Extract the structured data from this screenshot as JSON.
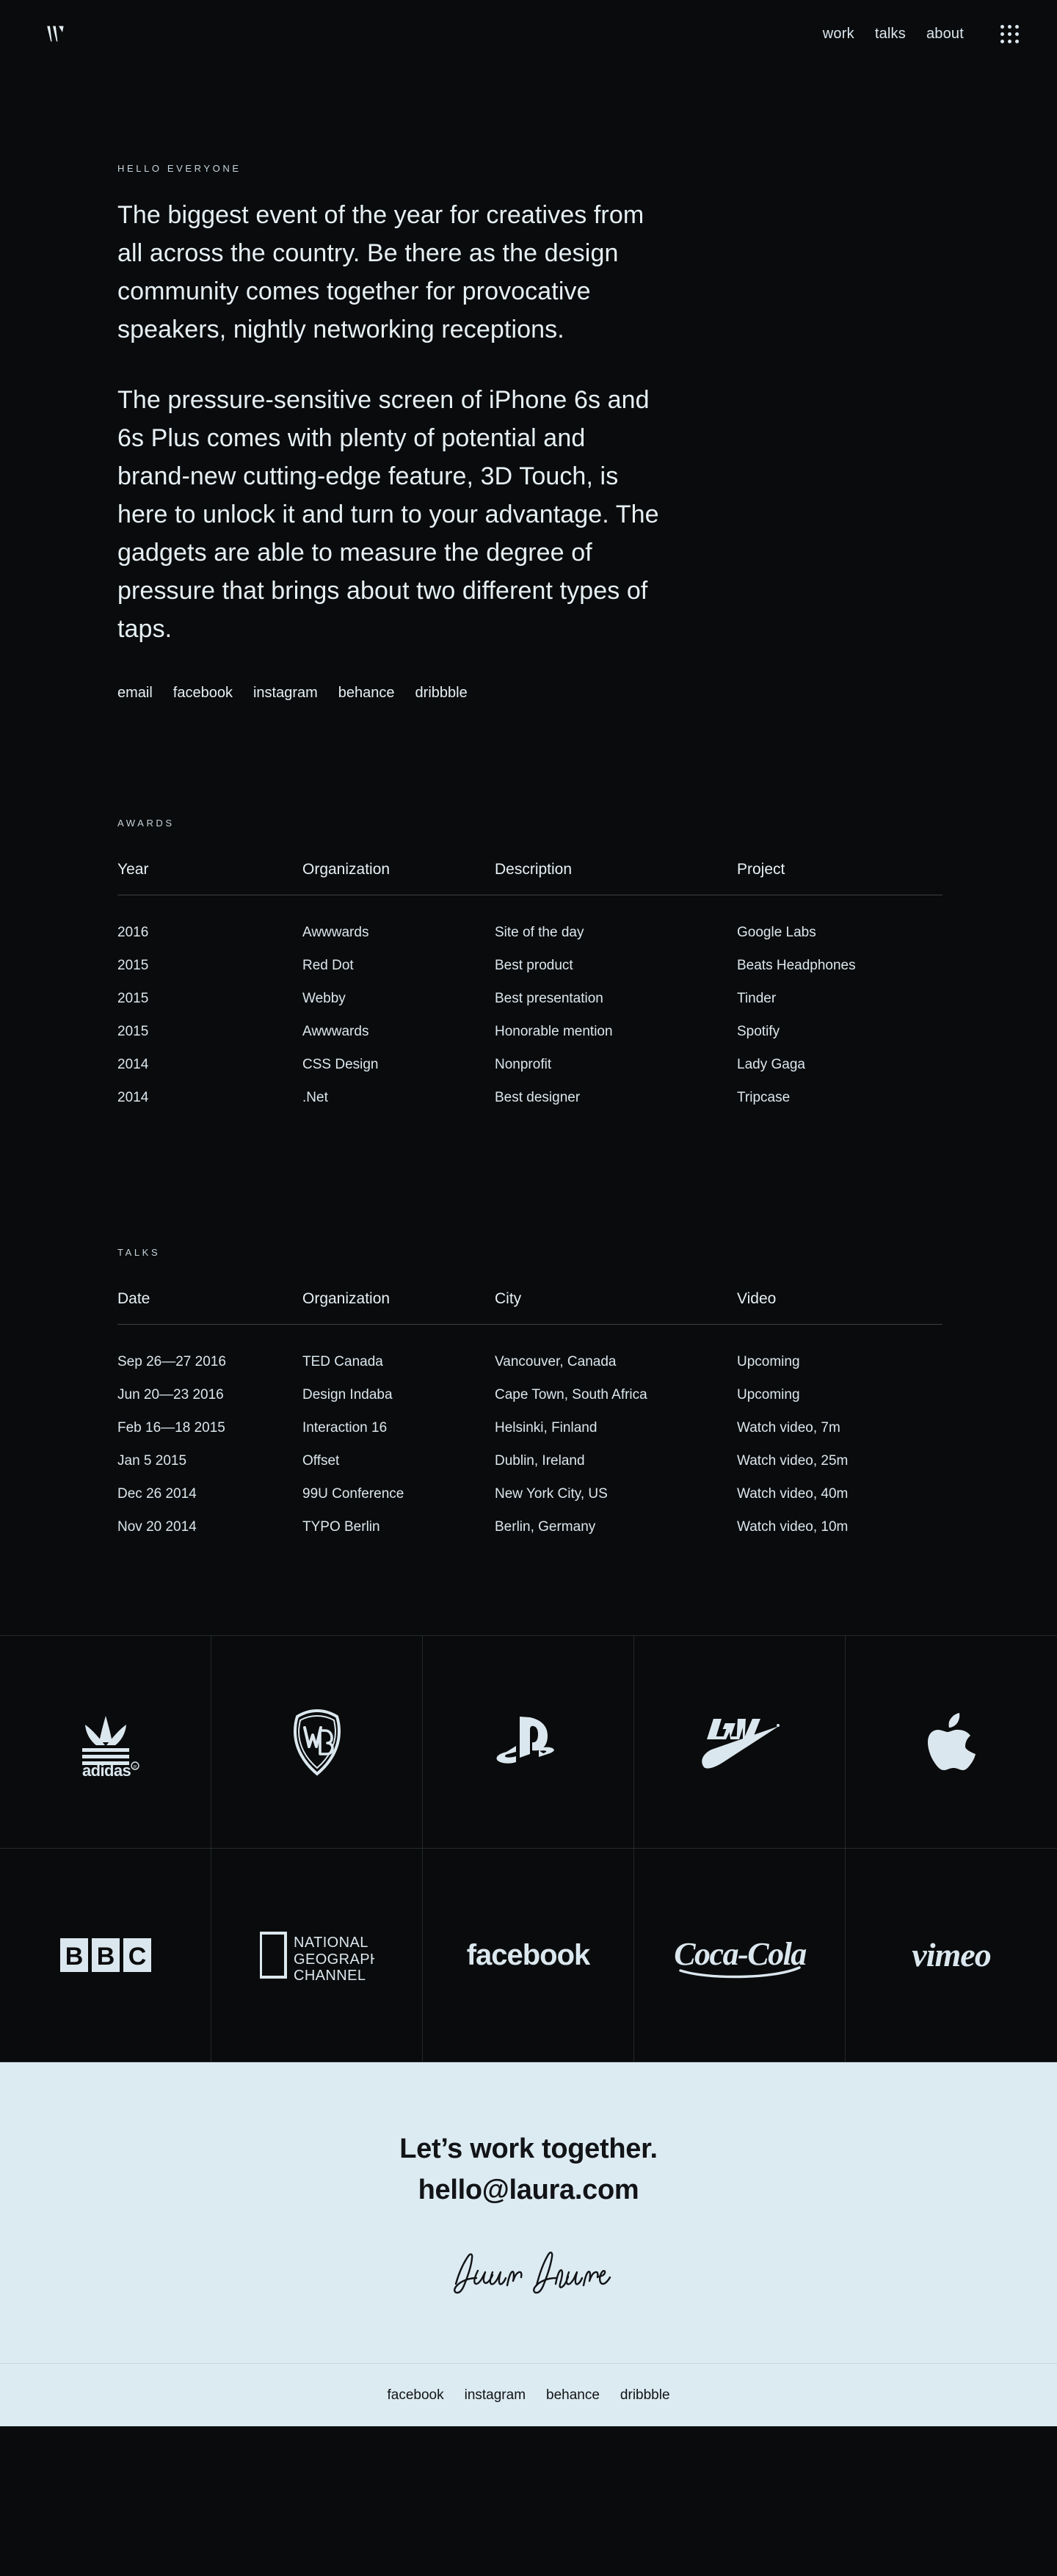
{
  "header": {
    "logo_alt": "W monogram",
    "nav": [
      {
        "label": "work"
      },
      {
        "label": "talks"
      },
      {
        "label": "about"
      }
    ],
    "menu_icon": "grid-dots-icon"
  },
  "intro": {
    "eyebrow": "HELLO EVERYONE",
    "paragraph_1": "The biggest event of the year for creatives from all across the country. Be there as the design community comes together for provocative speakers, nightly networking receptions.",
    "paragraph_2": "The pressure-sensitive screen of iPhone 6s and 6s Plus comes with plenty of potential and brand-new cutting-edge feature, 3D Touch, is here to unlock it and turn to your advantage. The gadgets are able to measure the degree of pressure that brings about two different types of taps.",
    "social_links": [
      {
        "label": "email"
      },
      {
        "label": "facebook"
      },
      {
        "label": "instagram"
      },
      {
        "label": "behance"
      },
      {
        "label": "dribbble"
      }
    ]
  },
  "awards": {
    "label": "AWARDS",
    "columns": [
      "Year",
      "Organization",
      "Description",
      "Project"
    ],
    "rows": [
      {
        "year": "2016",
        "org": "Awwwards",
        "desc": "Site of the day",
        "project": "Google Labs"
      },
      {
        "year": "2015",
        "org": "Red Dot",
        "desc": "Best product",
        "project": "Beats Headphones"
      },
      {
        "year": "2015",
        "org": "Webby",
        "desc": "Best presentation",
        "project": "Tinder"
      },
      {
        "year": "2015",
        "org": "Awwwards",
        "desc": "Honorable mention",
        "project": "Spotify"
      },
      {
        "year": "2014",
        "org": "CSS Design",
        "desc": "Nonprofit",
        "project": "Lady Gaga"
      },
      {
        "year": "2014",
        "org": ".Net",
        "desc": "Best designer",
        "project": "Tripcase"
      }
    ]
  },
  "talks": {
    "label": "TALKS",
    "columns": [
      "Date",
      "Organization",
      "City",
      "Video"
    ],
    "rows": [
      {
        "date": "Sep 26—27 2016",
        "org": "TED Canada",
        "city": "Vancouver, Canada",
        "video": "Upcoming",
        "video_muted": true
      },
      {
        "date": "Jun 20—23 2016",
        "org": "Design Indaba",
        "city": "Cape Town, South Africa",
        "video": "Upcoming",
        "video_muted": true
      },
      {
        "date": "Feb 16—18 2015",
        "org": "Interaction 16",
        "city": "Helsinki, Finland",
        "video": "Watch video, 7m",
        "video_muted": false
      },
      {
        "date": "Jan 5 2015",
        "org": "Offset",
        "city": "Dublin, Ireland",
        "video": "Watch video, 25m",
        "video_muted": false
      },
      {
        "date": "Dec 26 2014",
        "org": "99U Conference",
        "city": "New York City, US",
        "video": "Watch video, 40m",
        "video_muted": false
      },
      {
        "date": "Nov 20 2014",
        "org": "TYPO Berlin",
        "city": "Berlin, Germany",
        "video": "Watch video, 10m",
        "video_muted": false
      }
    ]
  },
  "clients": {
    "logos": [
      {
        "name": "adidas",
        "icon": "adidas-logo"
      },
      {
        "name": "Warner Bros",
        "icon": "warner-bros-logo"
      },
      {
        "name": "PlayStation",
        "icon": "playstation-logo"
      },
      {
        "name": "NIKE",
        "icon": "nike-logo"
      },
      {
        "name": "Apple",
        "icon": "apple-logo"
      },
      {
        "name": "BBC",
        "icon": "bbc-logo"
      },
      {
        "name": "NATIONAL GEOGRAPHIC CHANNEL",
        "icon": "national-geographic-logo"
      },
      {
        "name": "facebook",
        "icon": "facebook-logo"
      },
      {
        "name": "Coca-Cola",
        "icon": "coca-cola-logo"
      },
      {
        "name": "vimeo",
        "icon": "vimeo-logo"
      }
    ]
  },
  "cta": {
    "headline": "Let’s work together.",
    "email": "hello@laura.com",
    "signature": "Laura Palmer"
  },
  "footer": {
    "links": [
      {
        "label": "facebook"
      },
      {
        "label": "instagram"
      },
      {
        "label": "behance"
      },
      {
        "label": "dribbble"
      }
    ]
  },
  "colors": {
    "background": "#0a0b0c",
    "text": "#e6f0f5",
    "muted": "#5d6569",
    "rule": "#3a4247",
    "cta_background": "#dcebf2",
    "cta_text": "#121417"
  }
}
